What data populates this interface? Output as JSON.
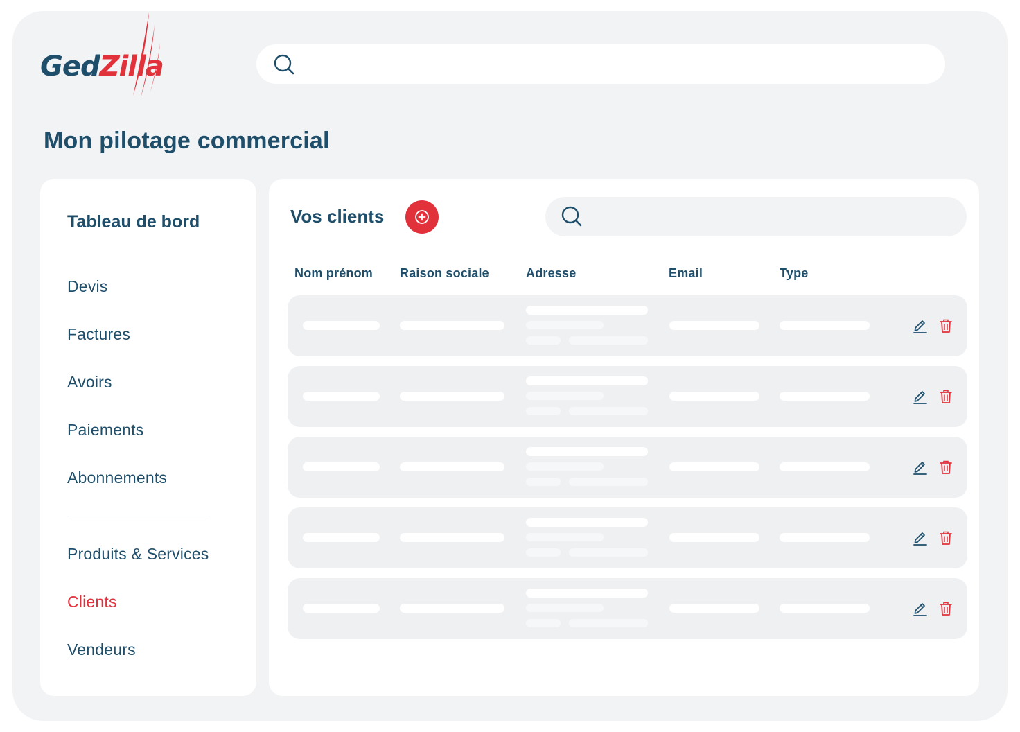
{
  "brand": {
    "name_part1": "Ged",
    "name_part2": "Zilla",
    "colors": {
      "primary": "#1f4e6b",
      "accent": "#e1323c",
      "background": "#f1f3f5",
      "surface": "#ffffff"
    }
  },
  "top_search": {
    "value": "",
    "placeholder": "",
    "icon": "search-icon"
  },
  "page_title": "Mon pilotage commercial",
  "sidebar": {
    "heading": "Tableau de bord",
    "items": [
      {
        "label": "Devis",
        "active": false
      },
      {
        "label": "Factures",
        "active": false
      },
      {
        "label": "Avoirs",
        "active": false
      },
      {
        "label": "Paiements",
        "active": false
      },
      {
        "label": "Abonnements",
        "active": false
      },
      {
        "label": "Produits & Services",
        "active": false
      },
      {
        "label": "Clients",
        "active": true
      },
      {
        "label": "Vendeurs",
        "active": false
      }
    ]
  },
  "clients": {
    "title": "Vos clients",
    "add_icon": "plus-circle-icon",
    "search": {
      "value": "",
      "placeholder": "",
      "icon": "search-icon"
    },
    "columns": [
      "Nom prénom",
      "Raison sociale",
      "Adresse",
      "Email",
      "Type"
    ],
    "row_actions": [
      "edit-icon",
      "trash-icon"
    ],
    "rows": [
      {},
      {},
      {},
      {},
      {}
    ]
  }
}
